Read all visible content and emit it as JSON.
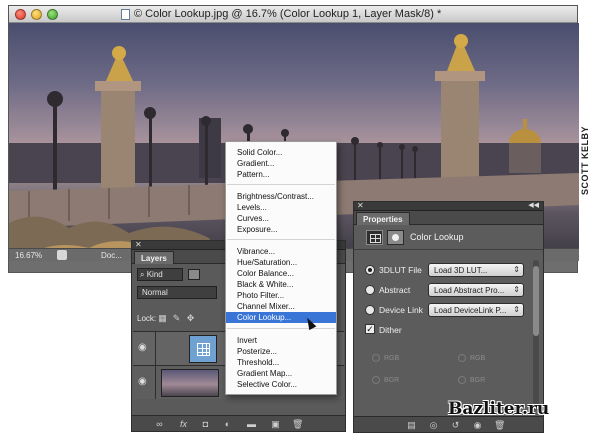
{
  "window": {
    "title": "© Color Lookup.jpg @ 16.7% (Color Lookup 1, Layer Mask/8) *",
    "zoom": "16.67%",
    "doc_info": "Doc..."
  },
  "credit": "SCOTT KELBY",
  "layers": {
    "tab": "Layers",
    "kind": "Kind",
    "blend_mode": "Normal",
    "lock_label": "Lock:"
  },
  "properties": {
    "tab": "Properties",
    "title": "Color Lookup",
    "rows": [
      {
        "label": "3DLUT File",
        "value": "Load 3D LUT...",
        "selected": true
      },
      {
        "label": "Abstract",
        "value": "Load Abstract Pro...",
        "selected": false
      },
      {
        "label": "Device Link",
        "value": "Load DeviceLink P...",
        "selected": false
      }
    ],
    "dither_label": "Dither",
    "dither_checked": true,
    "ghost_labels": [
      "RGB",
      "RGB",
      "BGR",
      "BGR"
    ]
  },
  "menu": {
    "groups": [
      [
        "Solid Color...",
        "Gradient...",
        "Pattern..."
      ],
      [
        "Brightness/Contrast...",
        "Levels...",
        "Curves...",
        "Exposure..."
      ],
      [
        "Vibrance...",
        "Hue/Saturation...",
        "Color Balance...",
        "Black & White...",
        "Photo Filter...",
        "Channel Mixer...",
        "Color Lookup..."
      ],
      [
        "Invert",
        "Posterize...",
        "Threshold...",
        "Gradient Map...",
        "Selective Color..."
      ]
    ],
    "selected": "Color Lookup..."
  },
  "watermark": "Bazliter.ru"
}
